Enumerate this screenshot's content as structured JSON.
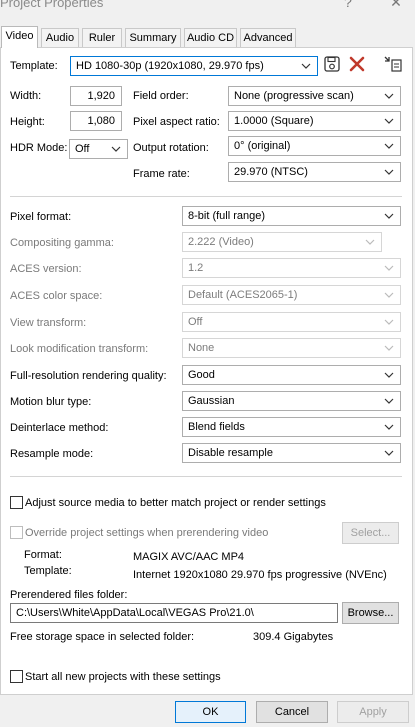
{
  "window": {
    "title": "Project Properties",
    "help_glyph": "?",
    "close_glyph": "✕"
  },
  "tabs": [
    {
      "label": "Video"
    },
    {
      "label": "Audio"
    },
    {
      "label": "Ruler"
    },
    {
      "label": "Summary"
    },
    {
      "label": "Audio CD"
    },
    {
      "label": "Advanced"
    }
  ],
  "template": {
    "label": "Template:",
    "value": "HD 1080-30p (1920x1080, 29.970 fps)"
  },
  "width": {
    "label": "Width:",
    "value": "1,920"
  },
  "height": {
    "label": "Height:",
    "value": "1,080"
  },
  "hdr": {
    "label": "HDR Mode:",
    "value": "Off"
  },
  "field_order": {
    "label": "Field order:",
    "value": "None (progressive scan)"
  },
  "pixel_aspect": {
    "label": "Pixel aspect ratio:",
    "value": "1.0000 (Square)"
  },
  "output_rotation": {
    "label": "Output rotation:",
    "value": "0° (original)"
  },
  "frame_rate": {
    "label": "Frame rate:",
    "value": "29.970 (NTSC)"
  },
  "settings": [
    {
      "label": "Pixel format:",
      "value": "8-bit (full range)",
      "enabled": true
    },
    {
      "label": "Compositing gamma:",
      "value": "2.222 (Video)",
      "enabled": false
    },
    {
      "label": "ACES version:",
      "value": "1.2",
      "enabled": false
    },
    {
      "label": "ACES color space:",
      "value": "Default (ACES2065-1)",
      "enabled": false
    },
    {
      "label": "View transform:",
      "value": "Off",
      "enabled": false
    },
    {
      "label": "Look modification transform:",
      "value": "None",
      "enabled": false
    },
    {
      "label": "Full-resolution rendering quality:",
      "value": "Good",
      "enabled": true
    },
    {
      "label": "Motion blur type:",
      "value": "Gaussian",
      "enabled": true
    },
    {
      "label": "Deinterlace method:",
      "value": "Blend fields",
      "enabled": true
    },
    {
      "label": "Resample mode:",
      "value": "Disable resample",
      "enabled": true
    }
  ],
  "adjust_source": {
    "label": "Adjust source media to better match project or render settings",
    "checked": false
  },
  "override": {
    "label": "Override project settings when prerendering video",
    "checked": false,
    "select_label": "Select..."
  },
  "prerender_format": {
    "label": "Format:",
    "value": "MAGIX AVC/AAC MP4"
  },
  "prerender_template": {
    "label": "Template:",
    "value": "Internet 1920x1080 29.970 fps progressive (NVEnc)"
  },
  "prerendered_folder": {
    "label": "Prerendered files folder:",
    "value": "C:\\Users\\White\\AppData\\Local\\VEGAS Pro\\21.0\\",
    "browse_label": "Browse..."
  },
  "free_space": {
    "label": "Free storage space in selected folder:",
    "value": "309.4 Gigabytes"
  },
  "start_all": {
    "label": "Start all new projects with these settings",
    "checked": false
  },
  "footer": {
    "ok_label": "OK",
    "cancel_label": "Cancel",
    "apply_label": "Apply"
  },
  "icons": {
    "save": "save-icon",
    "delete": "delete-x-icon",
    "match": "match-media-icon",
    "chevron": "chevron-down-icon"
  },
  "colors": {
    "accent": "#0078d7",
    "delete_red": "#c0392b",
    "panel_bg": "#ffffff",
    "window_bg": "#f0f0f0"
  }
}
